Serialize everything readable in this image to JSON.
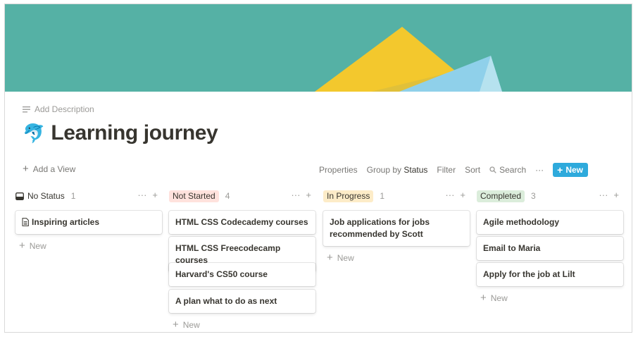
{
  "header": {
    "add_description": "Add Description",
    "title": "Learning journey",
    "emoji": "🐬"
  },
  "view_bar": {
    "add_view": "Add a View",
    "properties": "Properties",
    "group_by": "Group by",
    "group_by_value": "Status",
    "filter": "Filter",
    "sort": "Sort",
    "search": "Search",
    "more": "···",
    "new_label": "New"
  },
  "colors": {
    "cover_bg": "#55b1a5",
    "accent": "#2eaadc",
    "not_started_tag": "#ffe2dd",
    "in_progress_tag": "#fdecc8",
    "completed_tag": "#dbeddb"
  },
  "columns": [
    {
      "name": "No Status",
      "count": "1",
      "cards": [
        "Inspiring articles"
      ],
      "new_label": "New"
    },
    {
      "name": "Not Started",
      "count": "4",
      "cards": [
        "HTML CSS Codecademy courses",
        "HTML CSS Freecodecamp courses",
        "Harvard's CS50 course",
        "A plan what to do as next"
      ],
      "new_label": "New"
    },
    {
      "name": "In Progress",
      "count": "1",
      "cards": [
        "Job applications for jobs recommended by Scott"
      ],
      "new_label": "New"
    },
    {
      "name": "Completed",
      "count": "3",
      "cards": [
        "Agile methodology",
        "Email to Maria",
        "Apply for the job at Lilt"
      ],
      "new_label": "New"
    }
  ],
  "col_more": "···",
  "col_add": "+"
}
